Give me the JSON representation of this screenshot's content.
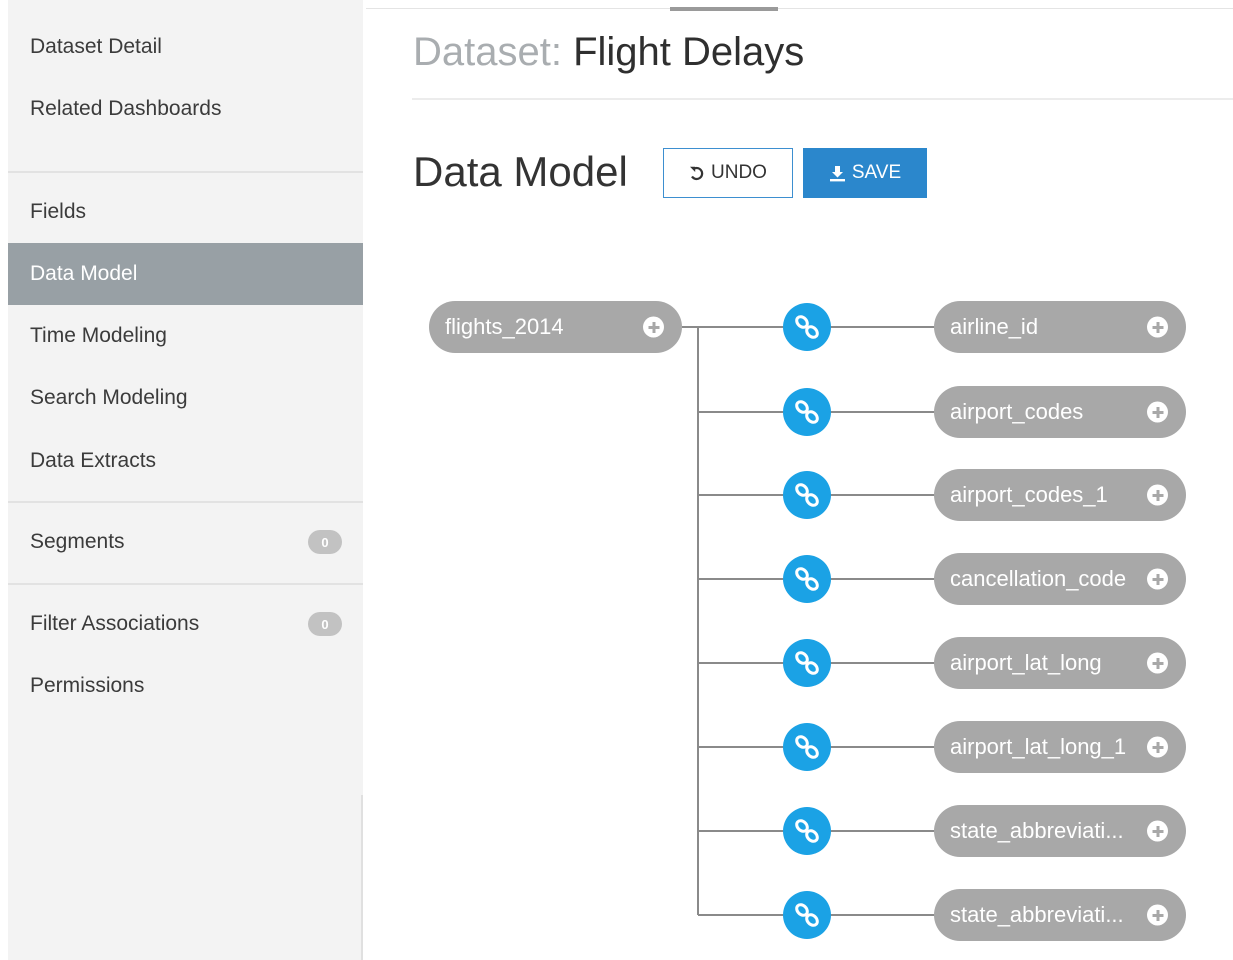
{
  "sidebar": {
    "items": [
      {
        "label": "Dataset Detail"
      },
      {
        "label": "Related Dashboards"
      },
      {
        "label": "Fields"
      },
      {
        "label": "Data Model"
      },
      {
        "label": "Time Modeling"
      },
      {
        "label": "Search Modeling"
      },
      {
        "label": "Data Extracts"
      },
      {
        "label": "Segments",
        "badge": "0"
      },
      {
        "label": "Filter Associations",
        "badge": "0"
      },
      {
        "label": "Permissions"
      }
    ],
    "active_item": "Data Model"
  },
  "header": {
    "title_prefix": "Dataset:",
    "title_name": "Flight Delays"
  },
  "section": {
    "title": "Data Model",
    "undo_label": "UNDO",
    "save_label": "SAVE",
    "undo_icon": "undo-icon",
    "save_icon": "download-icon"
  },
  "data_model": {
    "root": "flights_2014",
    "joins": [
      "airline_id",
      "airport_codes",
      "airport_codes_1",
      "cancellation_code",
      "airport_lat_long",
      "airport_lat_long_1",
      "state_abbreviati...",
      "state_abbreviati..."
    ],
    "link_icon": "link-icon",
    "add_icon": "plus-icon"
  },
  "colors": {
    "accent": "#2b87cc",
    "link_node": "#1ba2e5",
    "node_pill": "#a8a8a8",
    "sidebar_bg": "#f3f3f3",
    "sidebar_active": "#98a0a5"
  }
}
